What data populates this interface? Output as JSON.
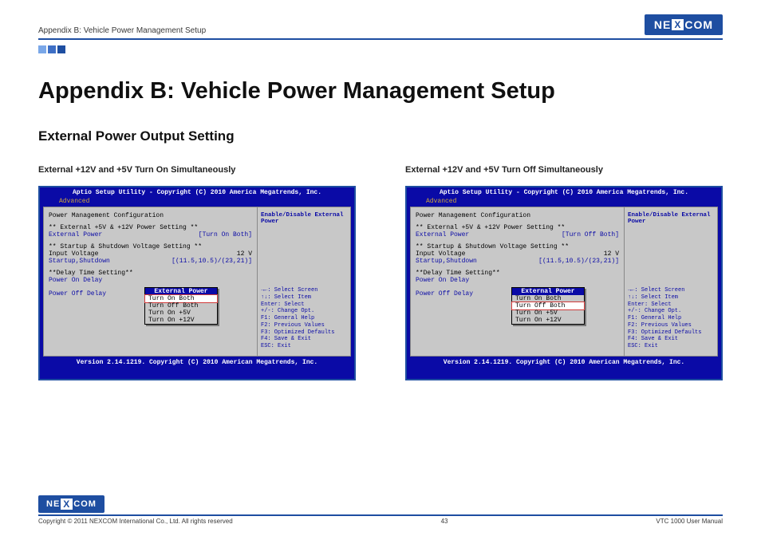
{
  "header": {
    "breadcrumb": "Appendix B: Vehicle Power Management Setup",
    "logo": "NEXCOM"
  },
  "title": "Appendix B: Vehicle Power Management Setup",
  "section": "External Power Output Setting",
  "panelCommon": {
    "biosTitle": "Aptio Setup Utility - Copyright (C) 2010 America Megatrends, Inc.",
    "tab": "Advanced",
    "version": "Version 2.14.1219. Copyright (C) 2010 American Megatrends, Inc.",
    "lines": {
      "config": "Power Management Configuration",
      "extHdr": "** External +5V & +12V Power Setting **",
      "extLabel": "External Power",
      "startHdr": "** Startup & Shutdown Voltage Setting **",
      "inVoltLabel": "Input Voltage",
      "inVoltVal": "12 V",
      "startLabel": "Startup,Shutdown",
      "startVal": "[(11.5,10.5)/(23,21)]",
      "delayHdr": "**Delay Time Setting**",
      "onDelay": "Power On Delay",
      "offDelay": "Power Off Delay"
    },
    "popup": {
      "title": "External Power",
      "opts": [
        "Turn On Both",
        "Turn Off Both",
        "Turn On +5V",
        "Turn On +12V"
      ]
    },
    "side": {
      "top": "Enable/Disable External Power",
      "help": [
        "→←: Select Screen",
        "↑↓: Select Item",
        "Enter: Select",
        "+/-: Change Opt.",
        "F1: General Help",
        "F2: Previous Values",
        "F3: Optimized Defaults",
        "F4: Save & Exit",
        "ESC: Exit"
      ]
    }
  },
  "panels": [
    {
      "heading": "External +12V and +5V Turn On Simultaneously",
      "extVal": "[Turn On Both]",
      "selected": 0
    },
    {
      "heading": "External +12V and +5V Turn Off Simultaneously",
      "extVal": "[Turn Off Both]",
      "selected": 1
    }
  ],
  "footer": {
    "copyright": "Copyright © 2011 NEXCOM International Co., Ltd. All rights reserved",
    "page": "43",
    "manual": "VTC 1000 User Manual"
  }
}
